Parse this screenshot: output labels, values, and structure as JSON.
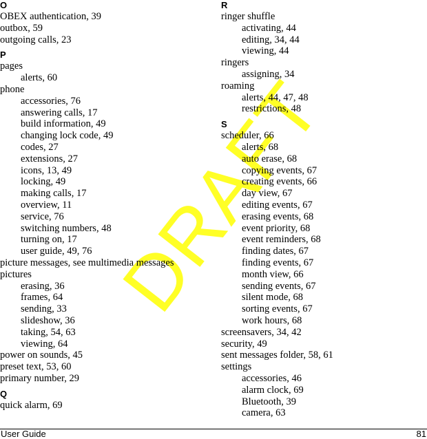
{
  "left_column": [
    {
      "letter": "O",
      "entries": [
        {
          "term": "OBEX authentication, 39",
          "subs": []
        },
        {
          "term": "outbox, 59",
          "subs": []
        },
        {
          "term": "outgoing calls, 23",
          "subs": []
        }
      ]
    },
    {
      "letter": "P",
      "entries": [
        {
          "term": "pages",
          "subs": [
            "alerts, 60"
          ]
        },
        {
          "term": "phone",
          "subs": [
            "accessories, 76",
            "answering calls, 17",
            "build information, 49",
            "changing lock code, 49",
            "codes, 27",
            "extensions, 27",
            "icons, 13, 49",
            "locking, 49",
            "making calls, 17",
            "overview, 11",
            "service, 76",
            "switching numbers, 48",
            "turning on, 17",
            "user guide, 49, 76"
          ]
        },
        {
          "term": "picture messages, see multimedia messages",
          "subs": []
        },
        {
          "term": "pictures",
          "subs": [
            "erasing, 36",
            "frames, 64",
            "sending, 33",
            "slideshow, 36",
            "taking, 54, 63",
            "viewing, 64"
          ]
        },
        {
          "term": "power on sounds, 45",
          "subs": []
        },
        {
          "term": "preset text, 53, 60",
          "subs": []
        },
        {
          "term": "primary number, 29",
          "subs": []
        }
      ]
    },
    {
      "letter": "Q",
      "entries": [
        {
          "term": "quick alarm, 69",
          "subs": []
        }
      ]
    }
  ],
  "right_column": [
    {
      "letter": "R",
      "entries": [
        {
          "term": "ringer shuffle",
          "subs": [
            "activating, 44",
            "editing, 34, 44",
            "viewing, 44"
          ]
        },
        {
          "term": "ringers",
          "subs": [
            "assigning, 34"
          ]
        },
        {
          "term": "roaming",
          "subs": [
            "alerts, 44, 47, 48",
            "restrictions, 48"
          ]
        }
      ]
    },
    {
      "letter": "S",
      "entries": [
        {
          "term": "scheduler, 66",
          "subs": [
            "alerts, 68",
            "auto erase, 68",
            "copying events, 67",
            "creating events, 66",
            "day view, 67",
            "editing events, 67",
            "erasing events, 68",
            "event priority, 68",
            "event reminders, 68",
            "finding dates, 67",
            "finding events, 67",
            "month view, 66",
            "sending events, 67",
            "silent mode, 68",
            "sorting events, 67",
            "work hours, 68"
          ]
        },
        {
          "term": "screensavers, 34, 42",
          "subs": []
        },
        {
          "term": "security, 49",
          "subs": []
        },
        {
          "term": "sent messages folder, 58, 61",
          "subs": []
        },
        {
          "term": "settings",
          "subs": [
            "accessories, 46",
            "alarm clock, 69",
            "Bluetooth, 39",
            "camera, 63"
          ]
        }
      ]
    }
  ],
  "footer": {
    "title": "User Guide",
    "page_number": "81"
  },
  "watermark": {
    "text": "DRAFT",
    "color": "#ffff00"
  }
}
